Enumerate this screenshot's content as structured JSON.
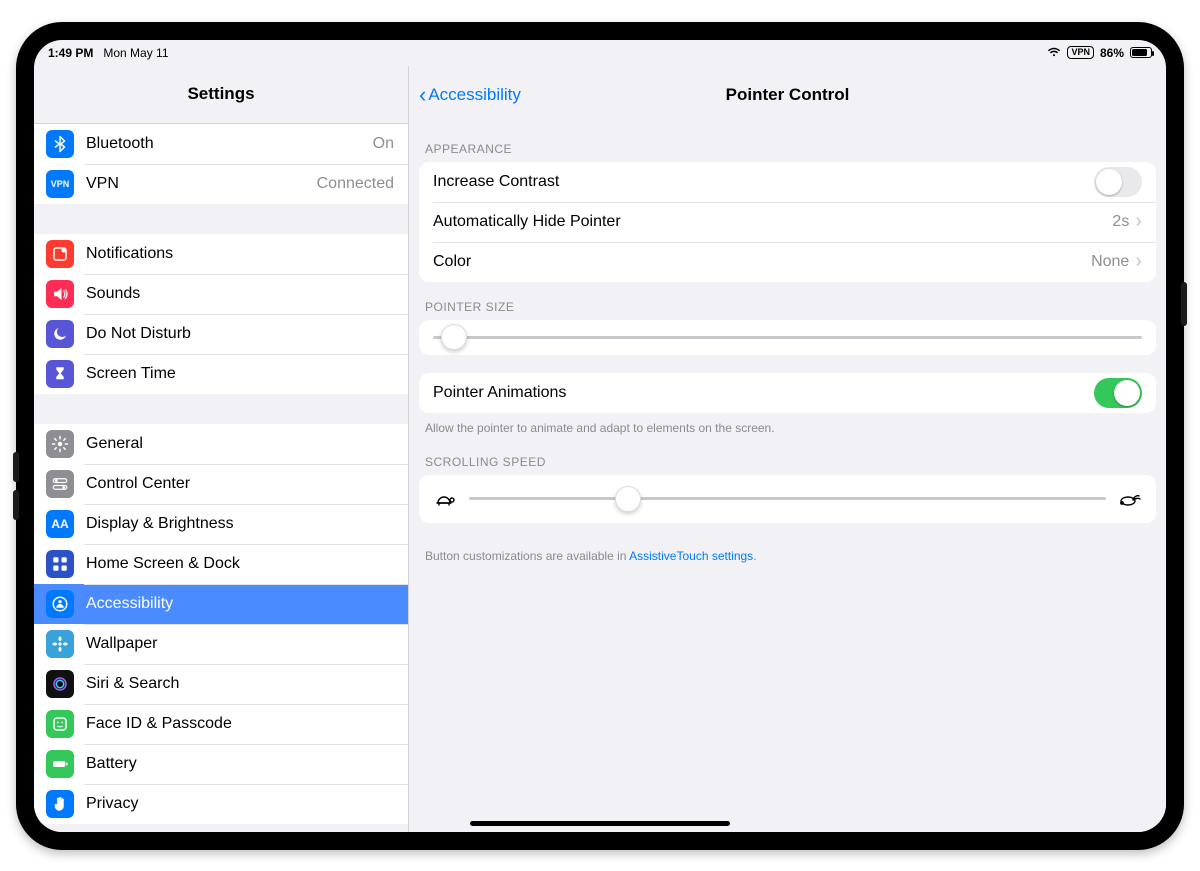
{
  "status": {
    "time": "1:49 PM",
    "date": "Mon May 11",
    "vpn_badge": "VPN",
    "battery_pct": "86%"
  },
  "sidebar": {
    "title": "Settings",
    "groups": [
      {
        "items": [
          {
            "name": "bluetooth",
            "label": "Bluetooth",
            "detail": "On",
            "icon": "bluetooth",
            "bg": "ib-blue"
          },
          {
            "name": "vpn",
            "label": "VPN",
            "detail": "Connected",
            "icon": "vpn-text",
            "bg": "ib-blue"
          }
        ]
      },
      {
        "items": [
          {
            "name": "notifications",
            "label": "Notifications",
            "icon": "notification",
            "bg": "ib-red"
          },
          {
            "name": "sounds",
            "label": "Sounds",
            "icon": "speaker",
            "bg": "ib-pink"
          },
          {
            "name": "do-not-disturb",
            "label": "Do Not Disturb",
            "icon": "moon",
            "bg": "ib-indigo"
          },
          {
            "name": "screen-time",
            "label": "Screen Time",
            "icon": "hourglass",
            "bg": "ib-indigo"
          }
        ]
      },
      {
        "items": [
          {
            "name": "general",
            "label": "General",
            "icon": "gear",
            "bg": "ib-gray"
          },
          {
            "name": "control-center",
            "label": "Control Center",
            "icon": "switches",
            "bg": "ib-gray"
          },
          {
            "name": "display",
            "label": "Display & Brightness",
            "icon": "aa",
            "bg": "ib-blue"
          },
          {
            "name": "home-screen",
            "label": "Home Screen & Dock",
            "icon": "grid",
            "bg": "ib-blue",
            "bg2": "#2b53c7"
          },
          {
            "name": "accessibility",
            "label": "Accessibility",
            "icon": "person-circle",
            "bg": "ib-blue",
            "selected": true
          },
          {
            "name": "wallpaper",
            "label": "Wallpaper",
            "icon": "flower",
            "bg": "ib-cyan"
          },
          {
            "name": "siri",
            "label": "Siri & Search",
            "icon": "siri",
            "bg": "ib-black"
          },
          {
            "name": "faceid",
            "label": "Face ID & Passcode",
            "icon": "face",
            "bg": "ib-green"
          },
          {
            "name": "battery",
            "label": "Battery",
            "icon": "battery",
            "bg": "ib-green"
          },
          {
            "name": "privacy",
            "label": "Privacy",
            "icon": "hand",
            "bg": "ib-blue"
          }
        ]
      }
    ]
  },
  "detail": {
    "back_label": "Accessibility",
    "title": "Pointer Control",
    "sections": {
      "appearance": {
        "header": "APPEARANCE",
        "increase_contrast_label": "Increase Contrast",
        "increase_contrast_on": false,
        "auto_hide_label": "Automatically Hide Pointer",
        "auto_hide_value": "2s",
        "color_label": "Color",
        "color_value": "None"
      },
      "pointer_size": {
        "header": "POINTER SIZE",
        "value_pct": 3
      },
      "animations": {
        "label": "Pointer Animations",
        "on": true,
        "footer": "Allow the pointer to animate and adapt to elements on the screen."
      },
      "scroll": {
        "header": "SCROLLING SPEED",
        "value_pct": 25
      },
      "footer_text": "Button customizations are available in ",
      "footer_link": "AssistiveTouch settings",
      "footer_tail": "."
    }
  }
}
